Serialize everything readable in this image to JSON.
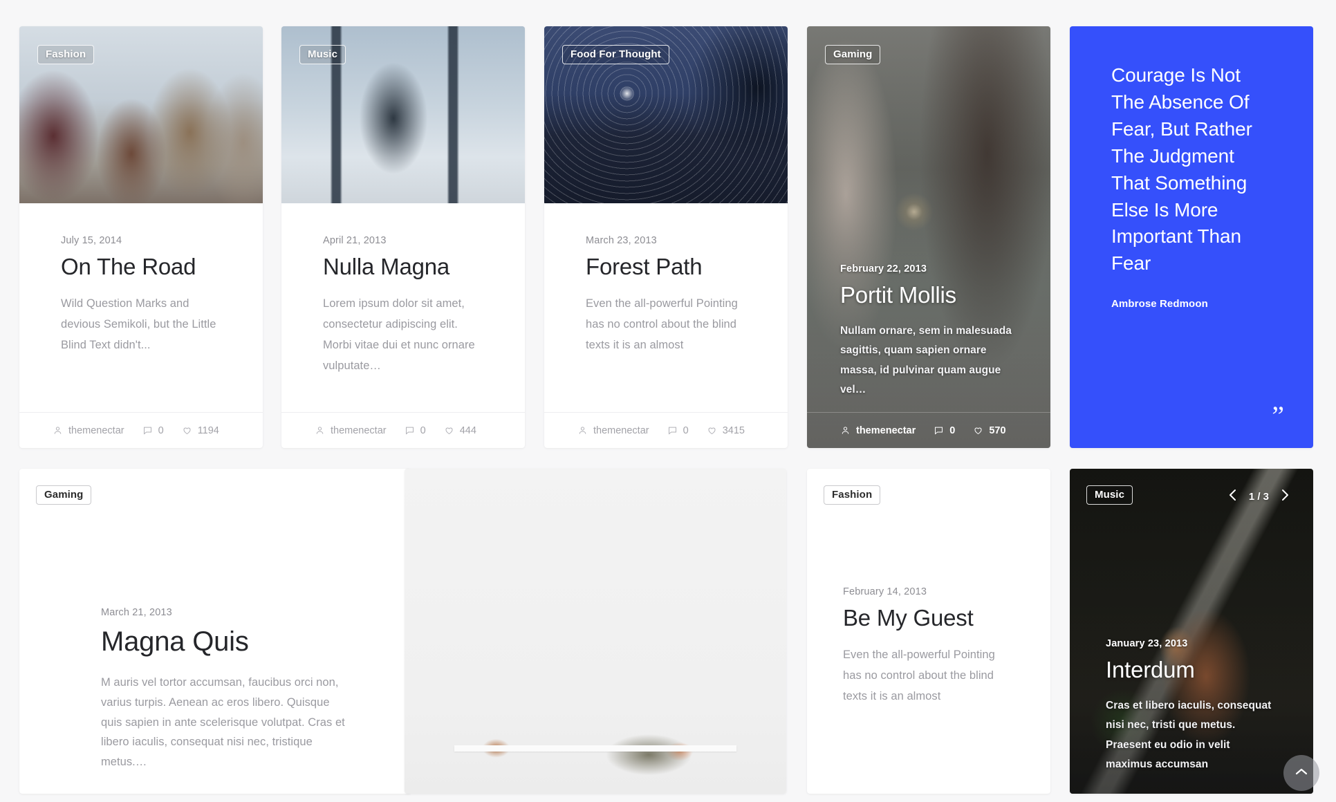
{
  "theme": {
    "page_background": "#f7f7f8",
    "quote_accent": "#3550fb",
    "card_background": "#ffffff",
    "title_color": "#25262a",
    "muted_text": "#9a9aa0"
  },
  "meta_labels": {
    "author_icon": "user-icon",
    "comment_icon": "comment-icon",
    "like_icon": "heart-icon"
  },
  "posts": [
    {
      "id": "on-the-road",
      "category": "Fashion",
      "date": "July 15, 2014",
      "title": "On The Road",
      "excerpt": "Wild Question Marks and devious Semikoli, but the Little Blind Text didn't...",
      "author": "themenectar",
      "comments": "0",
      "likes": "1194"
    },
    {
      "id": "nulla-magna",
      "category": "Music",
      "date": "April 21, 2013",
      "title": "Nulla Magna",
      "excerpt": "Lorem ipsum dolor sit amet, consectetur adipiscing elit. Morbi vitae dui et nunc ornare vulputate…",
      "author": "themenectar",
      "comments": "0",
      "likes": "444"
    },
    {
      "id": "forest-path",
      "category": "Food For Thought",
      "date": "March 23, 2013",
      "title": "Forest Path",
      "excerpt": "Even the all-powerful Pointing has no control about the blind texts it is an almost",
      "author": "themenectar",
      "comments": "0",
      "likes": "3415"
    },
    {
      "id": "portit-mollis",
      "category": "Gaming",
      "date": "February 22, 2013",
      "title": "Portit Mollis",
      "excerpt": "Nullam ornare, sem in malesuada sagittis, quam sapien ornare massa, id pulvinar quam augue vel…",
      "author": "themenectar",
      "comments": "0",
      "likes": "570"
    },
    {
      "id": "magna-quis",
      "category": "Gaming",
      "date": "March 21, 2013",
      "title": "Magna Quis",
      "excerpt": "M auris vel tortor accumsan, faucibus orci non, varius turpis. Aenean ac eros libero. Quisque quis sapien in ante scelerisque volutpat. Cras et libero iaculis, consequat nisi nec, tristique metus.…"
    },
    {
      "id": "be-my-guest",
      "category": "Fashion",
      "date": "February 14, 2013",
      "title": "Be My Guest",
      "excerpt": "Even the all-powerful Pointing has no control about the blind texts it is an almost"
    },
    {
      "id": "interdum",
      "category": "Music",
      "date": "January 23, 2013",
      "title": "Interdum",
      "excerpt": "Cras et libero iaculis, consequat nisi nec, tristi que metus. Praesent eu odio in velit maximus accumsan"
    }
  ],
  "quote_card": {
    "text": "Courage Is Not The Absence Of Fear, But Rather The Judgment That Something Else Is More Important Than Fear",
    "author": "Ambrose Redmoon",
    "icon": "quote-icon"
  },
  "slider": {
    "counter": "1 / 3",
    "prev_icon": "chevron-left-icon",
    "next_icon": "chevron-right-icon"
  },
  "scroll_top": {
    "icon": "chevron-up-icon"
  }
}
